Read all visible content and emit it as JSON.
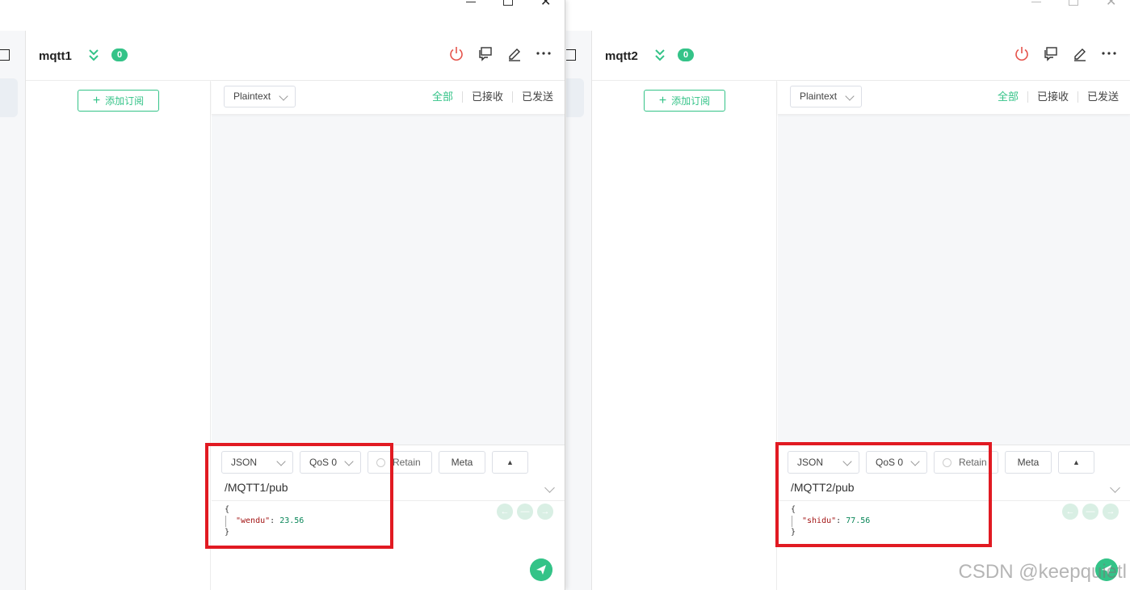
{
  "windows": [
    {
      "connection_name": "mqtt1",
      "badge_count": "0",
      "add_subscription_label": "添加订阅",
      "payload_format": "Plaintext",
      "filters": [
        "全部",
        "已接收",
        "已发送"
      ],
      "publish": {
        "format": "JSON",
        "qos": "QoS 0",
        "retain_label": "Retain",
        "meta_label": "Meta",
        "topic": "/MQTT1/pub",
        "payload_open": "{",
        "payload_key": "\"wendu\"",
        "payload_value": "23.56",
        "payload_close": "}"
      }
    },
    {
      "connection_name": "mqtt2",
      "badge_count": "0",
      "add_subscription_label": "添加订阅",
      "payload_format": "Plaintext",
      "filters": [
        "全部",
        "已接收",
        "已发送"
      ],
      "publish": {
        "format": "JSON",
        "qos": "QoS 0",
        "retain_label": "Retain",
        "meta_label": "Meta",
        "topic": "/MQTT2/pub",
        "payload_open": "{",
        "payload_key": "\"shidu\"",
        "payload_value": "77.56",
        "payload_close": "}"
      }
    }
  ],
  "watermark": "CSDN @keepquietl",
  "colors": {
    "accent": "#34c388",
    "highlight": "#e11a22",
    "disconnect": "#e5534b"
  },
  "icons": [
    "chevron-double-down-icon",
    "power-icon",
    "chat-icon",
    "edit-icon",
    "more-icon",
    "send-icon"
  ]
}
